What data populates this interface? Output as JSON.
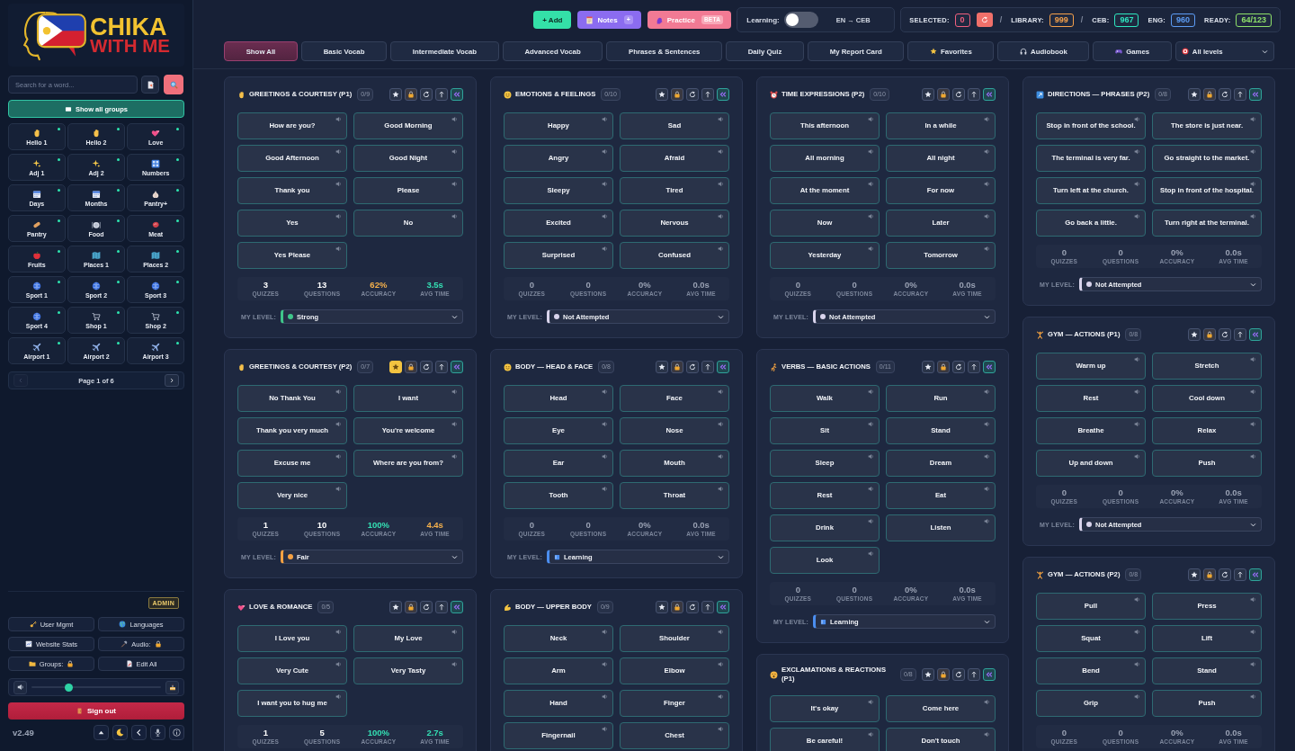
{
  "sidebar": {
    "logo": {
      "title": "CHIKA",
      "subtitle": "WITH ME"
    },
    "search": {
      "placeholder": "Search for a word..."
    },
    "show_all": "Show all groups",
    "groups": [
      {
        "label": "Hello 1",
        "kind": "greeting",
        "ready": true
      },
      {
        "label": "Hello 2",
        "kind": "greeting",
        "ready": true
      },
      {
        "label": "Love",
        "kind": "love",
        "ready": true
      },
      {
        "label": "Adj 1",
        "kind": "adjective",
        "ready": true
      },
      {
        "label": "Adj 2",
        "kind": "adjective",
        "ready": true
      },
      {
        "label": "Numbers",
        "kind": "number",
        "ready": true
      },
      {
        "label": "Days",
        "kind": "calendar",
        "ready": true
      },
      {
        "label": "Months",
        "kind": "calendar",
        "ready": true
      },
      {
        "label": "Pantry+",
        "kind": "spice",
        "ready": true
      },
      {
        "label": "Pantry",
        "kind": "staple",
        "ready": true
      },
      {
        "label": "Food",
        "kind": "food",
        "ready": true
      },
      {
        "label": "Meat",
        "kind": "meat",
        "ready": true
      },
      {
        "label": "Fruits",
        "kind": "fruit",
        "ready": true
      },
      {
        "label": "Places 1",
        "kind": "place",
        "ready": true
      },
      {
        "label": "Places 2",
        "kind": "place",
        "ready": true
      },
      {
        "label": "Sport 1",
        "kind": "sport",
        "ready": true
      },
      {
        "label": "Sport 2",
        "kind": "sport",
        "ready": true
      },
      {
        "label": "Sport 3",
        "kind": "sport",
        "ready": true
      },
      {
        "label": "Sport 4",
        "kind": "sport",
        "ready": true
      },
      {
        "label": "Shop 1",
        "kind": "shop",
        "ready": true
      },
      {
        "label": "Shop 2",
        "kind": "shop",
        "ready": true
      },
      {
        "label": "Airport 1",
        "kind": "airport",
        "ready": true
      },
      {
        "label": "Airport 2",
        "kind": "airport",
        "ready": true
      },
      {
        "label": "Airport 3",
        "kind": "airport",
        "ready": true
      }
    ],
    "pagination": {
      "label": "Page 1 of 6",
      "prev": {
        "disabled": true
      },
      "next": {
        "disabled": false
      }
    },
    "role": "ADMIN",
    "admin_buttons": [
      {
        "label": "User Mgmt",
        "kind": "users",
        "locked": false
      },
      {
        "label": "Languages",
        "kind": "languages",
        "locked": false
      },
      {
        "label": "Website Stats",
        "kind": "stats",
        "locked": false
      },
      {
        "label": "Audio:",
        "kind": "audio",
        "locked": true
      },
      {
        "label": "Groups:",
        "kind": "groups",
        "locked": true
      },
      {
        "label": "Edit All",
        "kind": "edit",
        "locked": false
      }
    ],
    "volume": {
      "level": 0.29
    },
    "sign_out": "Sign out",
    "version": "v2.49"
  },
  "toolbar": {
    "add": "+ Add",
    "notes": {
      "label": "Notes",
      "badge": "+"
    },
    "practice": {
      "label": "Practice",
      "badge": "BETA"
    },
    "learning": {
      "label": "Learning:",
      "on": false,
      "direction": "EN → CEB"
    },
    "stats": [
      {
        "kind": "counter",
        "label": "SELECTED:",
        "value": "0",
        "color": "#f0607e"
      },
      {
        "kind": "reset"
      },
      {
        "kind": "divider",
        "text": "/"
      },
      {
        "kind": "counter",
        "label": "LIBRARY:",
        "value": "999",
        "color": "#f5a04a"
      },
      {
        "kind": "divider",
        "text": "/"
      },
      {
        "kind": "counter",
        "label": "CEB:",
        "value": "967",
        "color": "#2ee6c0"
      },
      {
        "kind": "counter",
        "label": "ENG:",
        "value": "960",
        "color": "#5c9cf5"
      },
      {
        "kind": "counter",
        "label": "READY:",
        "value": "64/123",
        "color": "#8ee06a"
      }
    ]
  },
  "tabs": [
    {
      "label": "Show All",
      "kind": "plain",
      "selected": true
    },
    {
      "label": "Basic Vocab",
      "kind": "plain",
      "selected": false
    },
    {
      "label": "Intermediate Vocab",
      "kind": "plain",
      "selected": false
    },
    {
      "label": "Advanced Vocab",
      "kind": "plain",
      "selected": false
    },
    {
      "label": "Phrases & Sentences",
      "kind": "plain",
      "selected": false
    },
    {
      "label": "Daily Quiz",
      "kind": "plain",
      "selected": false
    },
    {
      "label": "My Report Card",
      "kind": "plain",
      "selected": false
    },
    {
      "label": "Favorites",
      "kind": "favorites",
      "selected": false
    },
    {
      "label": "Audiobook",
      "kind": "audiobook",
      "selected": false
    },
    {
      "label": "Games",
      "kind": "games",
      "selected": false
    }
  ],
  "level_filter": {
    "value": "All levels"
  },
  "board": {
    "columns": [
      [
        {
          "title": "GREETINGS & COURTESY (P1)",
          "kind": "greeting",
          "count": "0/9",
          "favorite": false,
          "words": [
            "How are you?",
            "Good Morning",
            "Good Afternoon",
            "Good Night",
            "Thank you",
            "Please",
            "Yes",
            "No",
            "Yes Please"
          ],
          "stats": [
            {
              "value": "3",
              "label": "QUIZZES",
              "color": "#ffffff"
            },
            {
              "value": "13",
              "label": "QUESTIONS",
              "color": "#ffffff"
            },
            {
              "value": "62%",
              "label": "ACCURACY",
              "color": "#f5b04c"
            },
            {
              "value": "3.5s",
              "label": "AVG TIME",
              "color": "#34e0b4"
            }
          ],
          "my_level": {
            "label": "MY LEVEL:",
            "value": "Strong",
            "kind": "dot",
            "color": "#3fc68a"
          }
        },
        {
          "title": "GREETINGS & COURTESY (P2)",
          "kind": "greeting",
          "count": "0/7",
          "favorite": true,
          "words": [
            "No Thank You",
            "I want",
            "Thank you very much",
            "You're welcome",
            "Excuse me",
            "Where are you from?",
            "Very nice"
          ],
          "stats": [
            {
              "value": "1",
              "label": "QUIZZES",
              "color": "#ffffff"
            },
            {
              "value": "10",
              "label": "QUESTIONS",
              "color": "#ffffff"
            },
            {
              "value": "100%",
              "label": "ACCURACY",
              "color": "#34e0b4"
            },
            {
              "value": "4.4s",
              "label": "AVG TIME",
              "color": "#f5b04c"
            }
          ],
          "my_level": {
            "label": "MY LEVEL:",
            "value": "Fair",
            "kind": "dot",
            "color": "#f5a142"
          }
        },
        {
          "title": "LOVE & ROMANCE",
          "kind": "love",
          "count": "0/5",
          "favorite": false,
          "words": [
            "I Love you",
            "My Love",
            "Very Cute",
            "Very Tasty",
            "I want you to hug me"
          ],
          "stats": [
            {
              "value": "1",
              "label": "QUIZZES",
              "color": "#ffffff"
            },
            {
              "value": "5",
              "label": "QUESTIONS",
              "color": "#ffffff"
            },
            {
              "value": "100%",
              "label": "ACCURACY",
              "color": "#34e0b4"
            },
            {
              "value": "2.7s",
              "label": "AVG TIME",
              "color": "#34e0b4"
            }
          ]
        }
      ],
      [
        {
          "title": "EMOTIONS & FEELINGS",
          "kind": "emotion",
          "count": "0/10",
          "favorite": false,
          "words": [
            "Happy",
            "Sad",
            "Angry",
            "Afraid",
            "Sleepy",
            "Tired",
            "Excited",
            "Nervous",
            "Surprised",
            "Confused"
          ],
          "stats": [
            {
              "value": "0",
              "label": "QUIZZES",
              "color": "#9aa2b4"
            },
            {
              "value": "0",
              "label": "QUESTIONS",
              "color": "#9aa2b4"
            },
            {
              "value": "0%",
              "label": "ACCURACY",
              "color": "#9aa2b4"
            },
            {
              "value": "0.0s",
              "label": "AVG TIME",
              "color": "#9aa2b4"
            }
          ],
          "my_level": {
            "label": "MY LEVEL:",
            "value": "Not Attempted",
            "kind": "dot",
            "color": "#d9d4ec"
          }
        },
        {
          "title": "BODY — HEAD & FACE",
          "kind": "face",
          "count": "0/8",
          "favorite": false,
          "words": [
            "Head",
            "Face",
            "Eye",
            "Nose",
            "Ear",
            "Mouth",
            "Tooth",
            "Throat"
          ],
          "stats": [
            {
              "value": "0",
              "label": "QUIZZES",
              "color": "#9aa2b4"
            },
            {
              "value": "0",
              "label": "QUESTIONS",
              "color": "#9aa2b4"
            },
            {
              "value": "0%",
              "label": "ACCURACY",
              "color": "#9aa2b4"
            },
            {
              "value": "0.0s",
              "label": "AVG TIME",
              "color": "#9aa2b4"
            }
          ],
          "my_level": {
            "label": "MY LEVEL:",
            "value": "Learning",
            "kind": "book",
            "color": "#4b8ef0"
          }
        },
        {
          "title": "BODY — UPPER BODY",
          "kind": "body",
          "count": "0/9",
          "favorite": false,
          "words": [
            "Neck",
            "Shoulder",
            "Arm",
            "Elbow",
            "Hand",
            "Finger",
            "Fingernail",
            "Chest"
          ]
        }
      ],
      [
        {
          "title": "TIME EXPRESSIONS (P2)",
          "kind": "time",
          "count": "0/10",
          "favorite": false,
          "words": [
            "This afternoon",
            "In a while",
            "All morning",
            "All night",
            "At the moment",
            "For now",
            "Now",
            "Later",
            "Yesterday",
            "Tomorrow"
          ],
          "stats": [
            {
              "value": "0",
              "label": "QUIZZES",
              "color": "#9aa2b4"
            },
            {
              "value": "0",
              "label": "QUESTIONS",
              "color": "#9aa2b4"
            },
            {
              "value": "0%",
              "label": "ACCURACY",
              "color": "#9aa2b4"
            },
            {
              "value": "0.0s",
              "label": "AVG TIME",
              "color": "#9aa2b4"
            }
          ],
          "my_level": {
            "label": "MY LEVEL:",
            "value": "Not Attempted",
            "kind": "dot",
            "color": "#d9d4ec"
          }
        },
        {
          "title": "VERBS — BASIC ACTIONS",
          "kind": "verb",
          "count": "0/11",
          "favorite": false,
          "words": [
            "Walk",
            "Run",
            "Sit",
            "Stand",
            "Sleep",
            "Dream",
            "Rest",
            "Eat",
            "Drink",
            "Listen",
            "Look"
          ],
          "stats": [
            {
              "value": "0",
              "label": "QUIZZES",
              "color": "#9aa2b4"
            },
            {
              "value": "0",
              "label": "QUESTIONS",
              "color": "#9aa2b4"
            },
            {
              "value": "0%",
              "label": "ACCURACY",
              "color": "#9aa2b4"
            },
            {
              "value": "0.0s",
              "label": "AVG TIME",
              "color": "#9aa2b4"
            }
          ],
          "my_level": {
            "label": "MY LEVEL:",
            "value": "Learning",
            "kind": "book",
            "color": "#4b8ef0"
          }
        },
        {
          "title": "EXCLAMATIONS & REACTIONS (P1)",
          "kind": "reaction",
          "count": "0/8",
          "favorite": false,
          "words": [
            "It's okay",
            "Come here",
            "Be careful!",
            "Don't touch"
          ]
        }
      ],
      [
        {
          "title": "DIRECTIONS — PHRASES (P2)",
          "kind": "direction",
          "count": "0/8",
          "favorite": false,
          "words": [
            "Stop in front of the school.",
            "The store is just near.",
            "The terminal is very far.",
            "Go straight to the market.",
            "Turn left at the church.",
            "Stop in front of the hospital.",
            "Go back a little.",
            "Turn right at the terminal."
          ],
          "stats": [
            {
              "value": "0",
              "label": "QUIZZES",
              "color": "#9aa2b4"
            },
            {
              "value": "0",
              "label": "QUESTIONS",
              "color": "#9aa2b4"
            },
            {
              "value": "0%",
              "label": "ACCURACY",
              "color": "#9aa2b4"
            },
            {
              "value": "0.0s",
              "label": "AVG TIME",
              "color": "#9aa2b4"
            }
          ],
          "my_level": {
            "label": "MY LEVEL:",
            "value": "Not Attempted",
            "kind": "dot",
            "color": "#d9d4ec"
          }
        },
        {
          "title": "GYM — ACTIONS (P1)",
          "kind": "exercise",
          "count": "0/8",
          "favorite": false,
          "words": [
            "Warm up",
            "Stretch",
            "Rest",
            "Cool down",
            "Breathe",
            "Relax",
            "Up and down",
            "Push"
          ],
          "stats": [
            {
              "value": "0",
              "label": "QUIZZES",
              "color": "#9aa2b4"
            },
            {
              "value": "0",
              "label": "QUESTIONS",
              "color": "#9aa2b4"
            },
            {
              "value": "0%",
              "label": "ACCURACY",
              "color": "#9aa2b4"
            },
            {
              "value": "0.0s",
              "label": "AVG TIME",
              "color": "#9aa2b4"
            }
          ],
          "my_level": {
            "label": "MY LEVEL:",
            "value": "Not Attempted",
            "kind": "dot",
            "color": "#d9d4ec"
          }
        },
        {
          "title": "GYM — ACTIONS (P2)",
          "kind": "exercise",
          "count": "0/8",
          "favorite": false,
          "words": [
            "Pull",
            "Press",
            "Squat",
            "Lift",
            "Bend",
            "Stand",
            "Grip",
            "Push"
          ],
          "stats": [
            {
              "value": "0",
              "label": "QUIZZES",
              "color": "#9aa2b4"
            },
            {
              "value": "0",
              "label": "QUESTIONS",
              "color": "#9aa2b4"
            },
            {
              "value": "0%",
              "label": "ACCURACY",
              "color": "#9aa2b4"
            },
            {
              "value": "0.0s",
              "label": "AVG TIME",
              "color": "#9aa2b4"
            }
          ]
        }
      ]
    ]
  }
}
